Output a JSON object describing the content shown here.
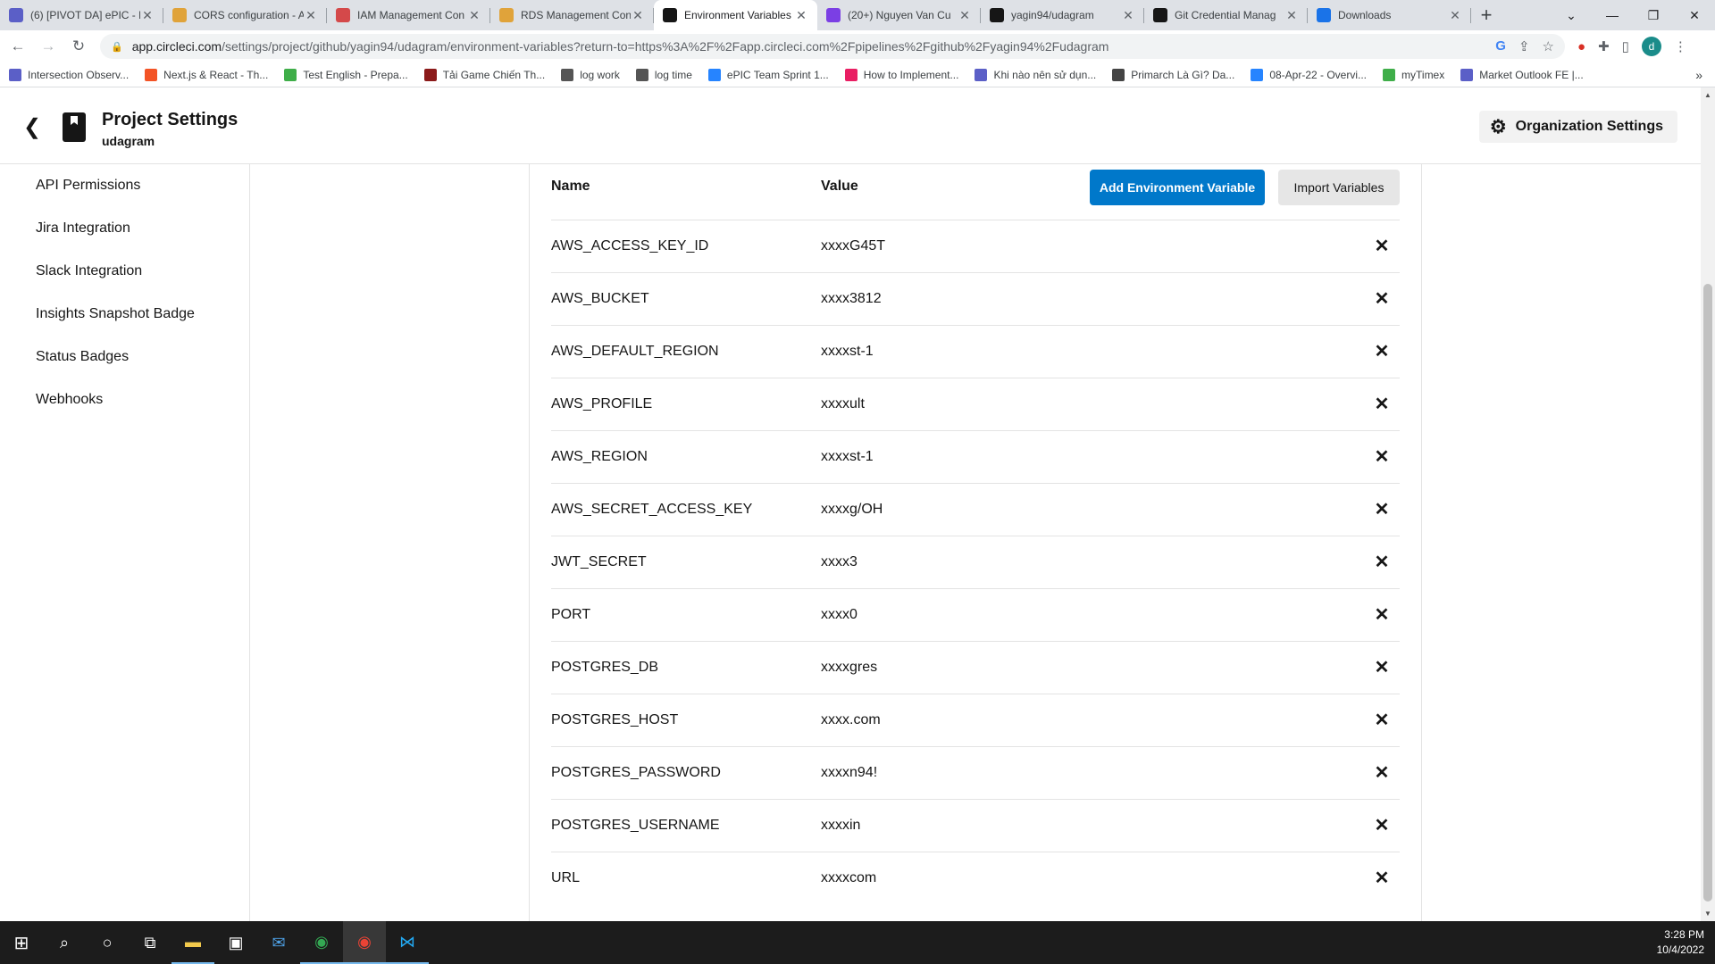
{
  "browser": {
    "tabs": [
      {
        "title": "(6) [PIVOT DA] ePIC - D",
        "icon": "teams-icon",
        "color": "#5b5fc7",
        "active": false
      },
      {
        "title": "CORS configuration - A",
        "icon": "aws-s3-icon",
        "color": "#e0a33a",
        "active": false
      },
      {
        "title": "IAM Management Con",
        "icon": "aws-iam-icon",
        "color": "#d4494a",
        "active": false
      },
      {
        "title": "RDS Management Con",
        "icon": "aws-rds-icon",
        "color": "#e0a33a",
        "active": false
      },
      {
        "title": "Environment Variables",
        "icon": "circleci-icon",
        "color": "#161616",
        "active": true
      },
      {
        "title": "(20+) Nguyen Van Cu",
        "icon": "messenger-icon",
        "color": "#7b3fe4",
        "active": false
      },
      {
        "title": "yagin94/udagram",
        "icon": "github-icon",
        "color": "#161616",
        "active": false
      },
      {
        "title": "Git Credential Manag",
        "icon": "github-icon",
        "color": "#161616",
        "active": false
      },
      {
        "title": "Downloads",
        "icon": "download-icon",
        "color": "#1a73e8",
        "active": false
      }
    ],
    "new_tab": "+",
    "url_host": "app.circleci.com",
    "url_path": "/settings/project/github/yagin94/udagram/environment-variables?return-to=https%3A%2F%2Fapp.circleci.com%2Fpipelines%2Fgithub%2Fyagin94%2Fudagram",
    "profile_initial": "d",
    "bookmarks": [
      {
        "label": "Intersection Observ...",
        "color": "#5b5fc7"
      },
      {
        "label": "Next.js & React - Th...",
        "color": "#f35325"
      },
      {
        "label": "Test English - Prepa...",
        "color": "#3fae49"
      },
      {
        "label": "Tải Game Chiến Th...",
        "color": "#8b1a1a"
      },
      {
        "label": "log work",
        "color": "#555555"
      },
      {
        "label": "log time",
        "color": "#555555"
      },
      {
        "label": "ePIC Team Sprint 1...",
        "color": "#2684ff"
      },
      {
        "label": "How to Implement...",
        "color": "#e91e63"
      },
      {
        "label": "Khi nào nên sử dụn...",
        "color": "#5b5fc7"
      },
      {
        "label": "Primarch Là Gì? Da...",
        "color": "#444444"
      },
      {
        "label": "08-Apr-22 - Overvi...",
        "color": "#2684ff"
      },
      {
        "label": "myTimex",
        "color": "#3fae49"
      },
      {
        "label": "Market Outlook FE |...",
        "color": "#5b5fc7"
      }
    ],
    "bookmarks_more": "»"
  },
  "header": {
    "title": "Project Settings",
    "subtitle": "udagram",
    "org_settings_label": "Organization Settings"
  },
  "sidebar": {
    "items": [
      {
        "label": "API Permissions"
      },
      {
        "label": "Jira Integration"
      },
      {
        "label": "Slack Integration"
      },
      {
        "label": "Insights Snapshot Badge"
      },
      {
        "label": "Status Badges"
      },
      {
        "label": "Webhooks"
      }
    ]
  },
  "env": {
    "col_name": "Name",
    "col_value": "Value",
    "add_label": "Add Environment Variable",
    "import_label": "Import Variables",
    "add_color": "#0078ca",
    "rows": [
      {
        "name": "AWS_ACCESS_KEY_ID",
        "value": "xxxxG45T"
      },
      {
        "name": "AWS_BUCKET",
        "value": "xxxx3812"
      },
      {
        "name": "AWS_DEFAULT_REGION",
        "value": "xxxxst-1"
      },
      {
        "name": "AWS_PROFILE",
        "value": "xxxxult"
      },
      {
        "name": "AWS_REGION",
        "value": "xxxxst-1"
      },
      {
        "name": "AWS_SECRET_ACCESS_KEY",
        "value": "xxxxg/OH"
      },
      {
        "name": "JWT_SECRET",
        "value": "xxxx3"
      },
      {
        "name": "PORT",
        "value": "xxxx0"
      },
      {
        "name": "POSTGRES_DB",
        "value": "xxxxgres"
      },
      {
        "name": "POSTGRES_HOST",
        "value": "xxxx.com"
      },
      {
        "name": "POSTGRES_PASSWORD",
        "value": "xxxxn94!"
      },
      {
        "name": "POSTGRES_USERNAME",
        "value": "xxxxin"
      },
      {
        "name": "URL",
        "value": "xxxxcom"
      }
    ]
  },
  "taskbar": {
    "time": "3:28 PM",
    "date": "10/4/2022"
  }
}
